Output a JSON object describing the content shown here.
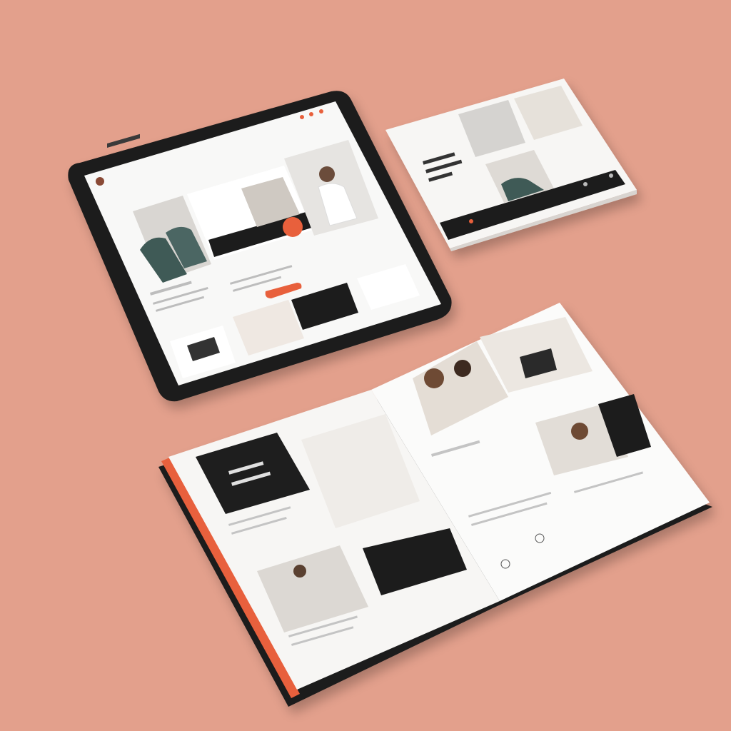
{
  "scene": {
    "background_color": "#e3a08c",
    "accent_color": "#e8603c",
    "dark_color": "#1c1c1c",
    "paper_color": "#f7f6f4"
  },
  "tablet": {
    "logo_text": "",
    "nav_items": [],
    "hero_title": "",
    "cta_label": ""
  },
  "small_brochure": {
    "headline": "",
    "footer_icons": [
      "home-icon",
      "user-icon",
      "mail-icon"
    ]
  },
  "magazine": {
    "left_page": {
      "feature_title": "",
      "headings": []
    },
    "right_page": {
      "headings": []
    }
  }
}
